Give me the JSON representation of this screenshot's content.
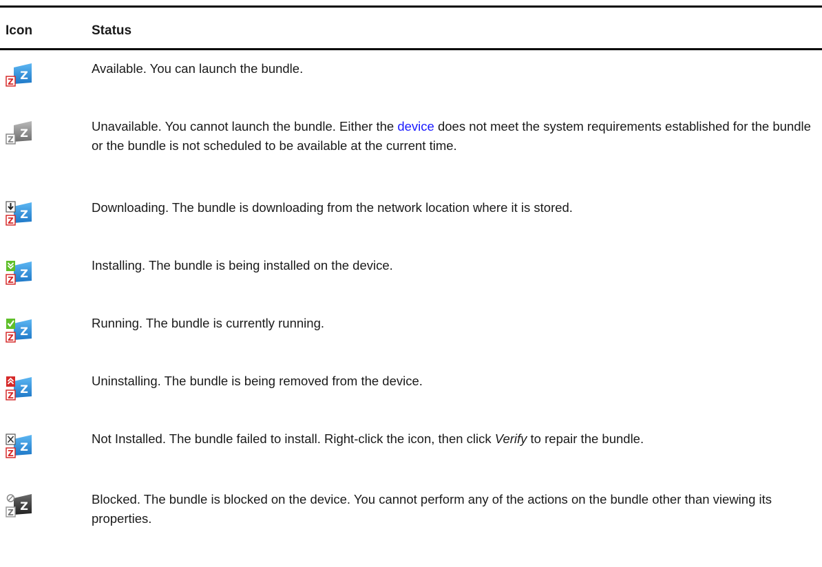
{
  "table": {
    "headers": {
      "icon": "Icon",
      "status": "Status"
    },
    "rows": [
      {
        "icon_name": "available-icon",
        "status_text": "Available. You can launch the bundle."
      },
      {
        "icon_name": "unavailable-icon",
        "status_before": "Unavailable. You cannot launch the bundle. Either the ",
        "status_link": "device",
        "status_after": " does not meet the system requirements established for the bundle or the bundle is not scheduled to be available at the current time."
      },
      {
        "icon_name": "downloading-icon",
        "status_text": "Downloading. The bundle is downloading from the network location where it is stored."
      },
      {
        "icon_name": "installing-icon",
        "status_text": "Installing. The bundle is being installed on the device."
      },
      {
        "icon_name": "running-icon",
        "status_text": "Running. The bundle is currently running."
      },
      {
        "icon_name": "uninstalling-icon",
        "status_text": "Uninstalling. The bundle is being removed from the device."
      },
      {
        "icon_name": "not-installed-icon",
        "status_before": "Not Installed. The bundle failed to install. Right-click the icon, then click ",
        "status_emphasis": "Verify",
        "status_after": " to repair the bundle."
      },
      {
        "icon_name": "blocked-icon",
        "status_text": "Blocked. The bundle is blocked on the device. You cannot perform any of the actions on the bundle other than viewing its properties."
      }
    ]
  },
  "colors": {
    "bundle_blue": "#2f8fe0",
    "bundle_gray": "#8a8a8a",
    "bundle_dark": "#3a3a3a",
    "link": "#1a1aff",
    "badge_red": "#d62a2a",
    "badge_green": "#5fbf2a"
  }
}
